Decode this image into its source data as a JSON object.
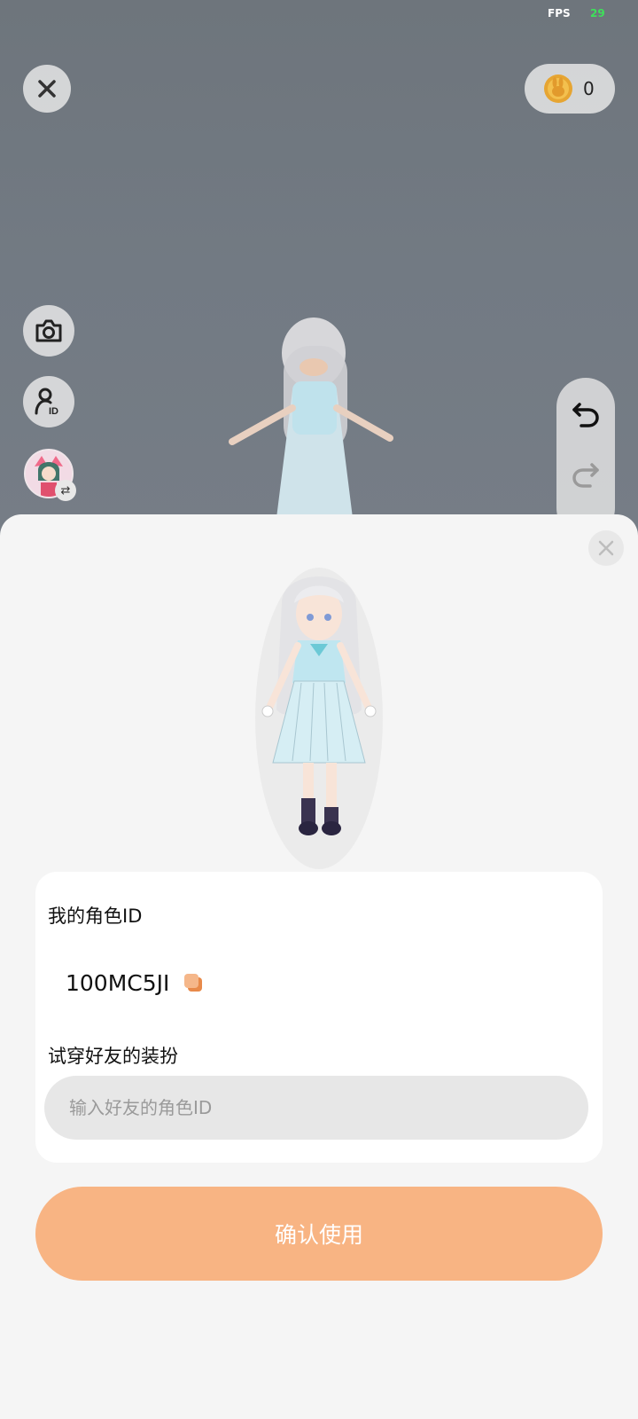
{
  "hud": {
    "fps_label": "FPS",
    "fps_value": "29",
    "coin_count": "0"
  },
  "character_id_card": {
    "my_id_title": "我的角色ID",
    "my_id_value": "100MC5JI",
    "try_on_title": "试穿好友的装扮",
    "friend_id_placeholder": "输入好友的角色ID"
  },
  "confirm_label": "确认使用",
  "icons": {
    "close": "close-icon",
    "coin": "rabbit-coin-icon",
    "camera": "camera-icon",
    "profile_id": "user-id-icon",
    "undo": "undo-icon",
    "redo": "redo-icon",
    "copy": "copy-icon",
    "swap": "swap-icon"
  },
  "colors": {
    "accent": "#f8b483",
    "fps_value": "#3ee05a"
  }
}
